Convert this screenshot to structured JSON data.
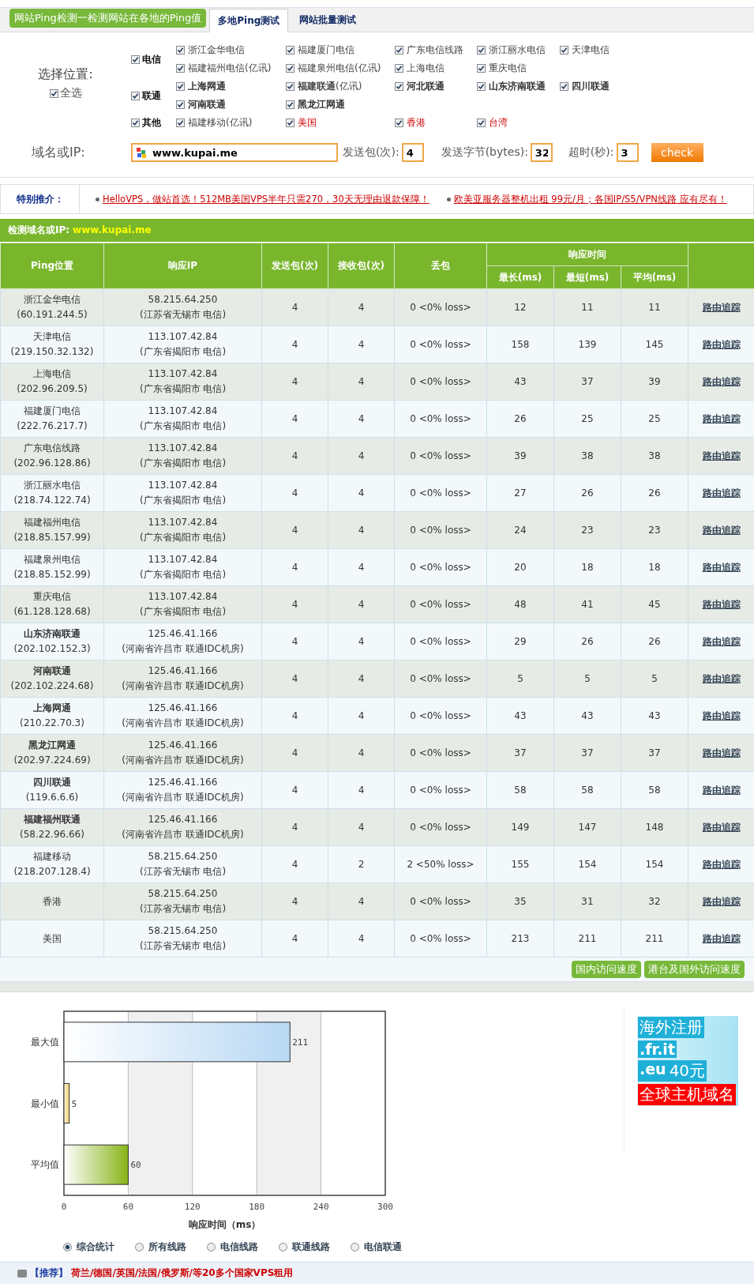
{
  "header": {
    "title": "网站Ping检测一检测网站在各地的Ping值",
    "tabs": [
      {
        "label": "多地Ping测试",
        "selected": true
      },
      {
        "label": "网站批量测试",
        "selected": false
      }
    ]
  },
  "locations": {
    "label": "选择位置:",
    "select_all": {
      "label": "全选",
      "checked": true
    },
    "groups": [
      {
        "label": "电信",
        "checked": true,
        "items": [
          {
            "label": "浙江金华电信",
            "checked": true,
            "kind": "normal"
          },
          {
            "label": "福建厦门电信",
            "checked": true,
            "kind": "normal"
          },
          {
            "label": "广东电信线路",
            "checked": true,
            "kind": "normal"
          },
          {
            "label": "浙江丽水电信",
            "checked": true,
            "kind": "normal"
          },
          {
            "label": "天津电信",
            "checked": true,
            "kind": "normal"
          },
          {
            "label": "福建福州电信(亿讯)",
            "checked": true,
            "kind": "normal"
          },
          {
            "label": "福建泉州电信(亿讯)",
            "checked": true,
            "kind": "normal"
          },
          {
            "label": "上海电信",
            "checked": true,
            "kind": "normal"
          },
          {
            "label": "重庆电信",
            "checked": true,
            "kind": "normal"
          }
        ]
      },
      {
        "label": "联通",
        "checked": true,
        "items": [
          {
            "label": "上海网通",
            "checked": true,
            "kind": "bold"
          },
          {
            "label": "福建联通(亿讯)",
            "checked": true,
            "kind": "boldpart"
          },
          {
            "label": "河北联通",
            "checked": true,
            "kind": "bold"
          },
          {
            "label": "山东济南联通",
            "checked": true,
            "kind": "bold"
          },
          {
            "label": "四川联通",
            "checked": true,
            "kind": "bold"
          },
          {
            "label": "河南联通",
            "checked": true,
            "kind": "bold"
          },
          {
            "label": "黑龙江网通",
            "checked": true,
            "kind": "bold"
          }
        ]
      },
      {
        "label": "其他",
        "checked": true,
        "items": [
          {
            "label": "福建移动(亿讯)",
            "checked": true,
            "kind": "normal"
          },
          {
            "label": "美国",
            "checked": true,
            "kind": "red"
          },
          {
            "label": "香港",
            "checked": true,
            "kind": "red"
          },
          {
            "label": "台湾",
            "checked": true,
            "kind": "red"
          }
        ]
      }
    ]
  },
  "query": {
    "host_label": "域名或IP:",
    "host": "www.kupai.me",
    "packets_label": "发送包(次):",
    "packets": "4",
    "bytes_label": "发送字节(bytes):",
    "bytes": "32",
    "timeout_label": "超时(秒):",
    "timeout": "3",
    "button": "check"
  },
  "promo": {
    "label": "特别推介：",
    "links": [
      "HelloVPS，做站首选！512MB美国VPS半年只需270，30天无理由退款保障！",
      "欧美亚服务器整机出租 99元/月；各国IP/S5/VPN线路 应有尽有！"
    ]
  },
  "results": {
    "title_label": "检测域名或IP:",
    "title_host": "www.kupai.me",
    "columns": [
      "Ping位置",
      "响应IP",
      "发送包(次)",
      "接收包(次)",
      "丢包",
      "响应时间",
      "最长(ms)",
      "最短(ms)",
      "平均(ms)"
    ],
    "rows": [
      {
        "location": "浙江金华电信",
        "location_ip": "(60.191.244.5)",
        "bold": false,
        "ip": "58.215.64.250",
        "ip_place": "(江苏省无锡市 电信)",
        "sent": "4",
        "received": "4",
        "loss": "0 <0% loss>",
        "max": "12",
        "min": "11",
        "avg": "11",
        "action": "路由追踪"
      },
      {
        "location": "天津电信",
        "location_ip": "(219.150.32.132)",
        "bold": false,
        "ip": "113.107.42.84",
        "ip_place": "(广东省揭阳市 电信)",
        "sent": "4",
        "received": "4",
        "loss": "0 <0% loss>",
        "max": "158",
        "min": "139",
        "avg": "145",
        "action": "路由追踪"
      },
      {
        "location": "上海电信",
        "location_ip": "(202.96.209.5)",
        "bold": false,
        "ip": "113.107.42.84",
        "ip_place": "(广东省揭阳市 电信)",
        "sent": "4",
        "received": "4",
        "loss": "0 <0% loss>",
        "max": "43",
        "min": "37",
        "avg": "39",
        "action": "路由追踪"
      },
      {
        "location": "福建厦门电信",
        "location_ip": "(222.76.217.7)",
        "bold": false,
        "ip": "113.107.42.84",
        "ip_place": "(广东省揭阳市 电信)",
        "sent": "4",
        "received": "4",
        "loss": "0 <0% loss>",
        "max": "26",
        "min": "25",
        "avg": "25",
        "action": "路由追踪"
      },
      {
        "location": "广东电信线路",
        "location_ip": "(202.96.128.86)",
        "bold": false,
        "ip": "113.107.42.84",
        "ip_place": "(广东省揭阳市 电信)",
        "sent": "4",
        "received": "4",
        "loss": "0 <0% loss>",
        "max": "39",
        "min": "38",
        "avg": "38",
        "action": "路由追踪"
      },
      {
        "location": "浙江丽水电信",
        "location_ip": "(218.74.122.74)",
        "bold": false,
        "ip": "113.107.42.84",
        "ip_place": "(广东省揭阳市 电信)",
        "sent": "4",
        "received": "4",
        "loss": "0 <0% loss>",
        "max": "27",
        "min": "26",
        "avg": "26",
        "action": "路由追踪"
      },
      {
        "location": "福建福州电信",
        "location_ip": "(218.85.157.99)",
        "bold": false,
        "ip": "113.107.42.84",
        "ip_place": "(广东省揭阳市 电信)",
        "sent": "4",
        "received": "4",
        "loss": "0 <0% loss>",
        "max": "24",
        "min": "23",
        "avg": "23",
        "action": "路由追踪"
      },
      {
        "location": "福建泉州电信",
        "location_ip": "(218.85.152.99)",
        "bold": false,
        "ip": "113.107.42.84",
        "ip_place": "(广东省揭阳市 电信)",
        "sent": "4",
        "received": "4",
        "loss": "0 <0% loss>",
        "max": "20",
        "min": "18",
        "avg": "18",
        "action": "路由追踪"
      },
      {
        "location": "重庆电信",
        "location_ip": "(61.128.128.68)",
        "bold": false,
        "ip": "113.107.42.84",
        "ip_place": "(广东省揭阳市 电信)",
        "sent": "4",
        "received": "4",
        "loss": "0 <0% loss>",
        "max": "48",
        "min": "41",
        "avg": "45",
        "action": "路由追踪"
      },
      {
        "location": "山东济南联通",
        "location_ip": "(202.102.152.3)",
        "bold": true,
        "ip": "125.46.41.166",
        "ip_place": "(河南省许昌市 联通IDC机房)",
        "sent": "4",
        "received": "4",
        "loss": "0 <0% loss>",
        "max": "29",
        "min": "26",
        "avg": "26",
        "action": "路由追踪"
      },
      {
        "location": "河南联通",
        "location_ip": "(202.102.224.68)",
        "bold": true,
        "ip": "125.46.41.166",
        "ip_place": "(河南省许昌市 联通IDC机房)",
        "sent": "4",
        "received": "4",
        "loss": "0 <0% loss>",
        "max": "5",
        "min": "5",
        "avg": "5",
        "action": "路由追踪"
      },
      {
        "location": "上海网通",
        "location_ip": "(210.22.70.3)",
        "bold": true,
        "ip": "125.46.41.166",
        "ip_place": "(河南省许昌市 联通IDC机房)",
        "sent": "4",
        "received": "4",
        "loss": "0 <0% loss>",
        "max": "43",
        "min": "43",
        "avg": "43",
        "action": "路由追踪"
      },
      {
        "location": "黑龙江网通",
        "location_ip": "(202.97.224.69)",
        "bold": true,
        "ip": "125.46.41.166",
        "ip_place": "(河南省许昌市 联通IDC机房)",
        "sent": "4",
        "received": "4",
        "loss": "0 <0% loss>",
        "max": "37",
        "min": "37",
        "avg": "37",
        "action": "路由追踪"
      },
      {
        "location": "四川联通",
        "location_ip": "(119.6.6.6)",
        "bold": true,
        "ip": "125.46.41.166",
        "ip_place": "(河南省许昌市 联通IDC机房)",
        "sent": "4",
        "received": "4",
        "loss": "0 <0% loss>",
        "max": "58",
        "min": "58",
        "avg": "58",
        "action": "路由追踪"
      },
      {
        "location": "福建福州联通",
        "location_ip": "(58.22.96.66)",
        "bold": true,
        "ip": "125.46.41.166",
        "ip_place": "(河南省许昌市 联通IDC机房)",
        "sent": "4",
        "received": "4",
        "loss": "0 <0% loss>",
        "max": "149",
        "min": "147",
        "avg": "148",
        "action": "路由追踪"
      },
      {
        "location": "福建移动",
        "location_ip": "(218.207.128.4)",
        "bold": false,
        "ip": "58.215.64.250",
        "ip_place": "(江苏省无锡市 电信)",
        "sent": "4",
        "received": "2",
        "loss": "2 <50% loss>",
        "max": "155",
        "min": "154",
        "avg": "154",
        "action": "路由追踪"
      },
      {
        "location": "香港",
        "bold": false,
        "ip": "58.215.64.250",
        "ip_place": "(江苏省无锡市 电信)",
        "sent": "4",
        "received": "4",
        "loss": "0 <0% loss>",
        "max": "35",
        "min": "31",
        "avg": "32",
        "action": "路由追踪"
      },
      {
        "location": "美国",
        "bold": false,
        "ip": "58.215.64.250",
        "ip_place": "(江苏省无锡市 电信)",
        "sent": "4",
        "received": "4",
        "loss": "0 <0% loss>",
        "max": "213",
        "min": "211",
        "avg": "211",
        "action": "路由追踪"
      }
    ],
    "buttons": [
      "国内访问速度",
      "港台及国外访问速度"
    ]
  },
  "summary": {
    "chart_data": {
      "type": "bar",
      "orientation": "horizontal",
      "xlabel": "响应时间（ms）",
      "categories": [
        "最大值",
        "最小值",
        "平均值"
      ],
      "values": [
        211,
        5,
        60
      ],
      "xlim": [
        0,
        300
      ],
      "xticks": [
        0,
        60,
        120,
        180,
        240,
        300
      ],
      "grid": true,
      "data_labels": true
    },
    "views": [
      {
        "label": "综合统计",
        "selected": true
      },
      {
        "label": "所有线路",
        "selected": false
      },
      {
        "label": "电信线路",
        "selected": false
      },
      {
        "label": "联通线路",
        "selected": false
      },
      {
        "label": "电信联通",
        "selected": false
      }
    ],
    "ad": {
      "lines": [
        "海外注册",
        ".fr.it",
        ".eu",
        "40元",
        "全球主机域名"
      ]
    }
  },
  "footer": {
    "tag": "【推荐】",
    "text": "荷兰/德国/英国/法国/俄罗斯/等20多个国家VPS租用"
  }
}
